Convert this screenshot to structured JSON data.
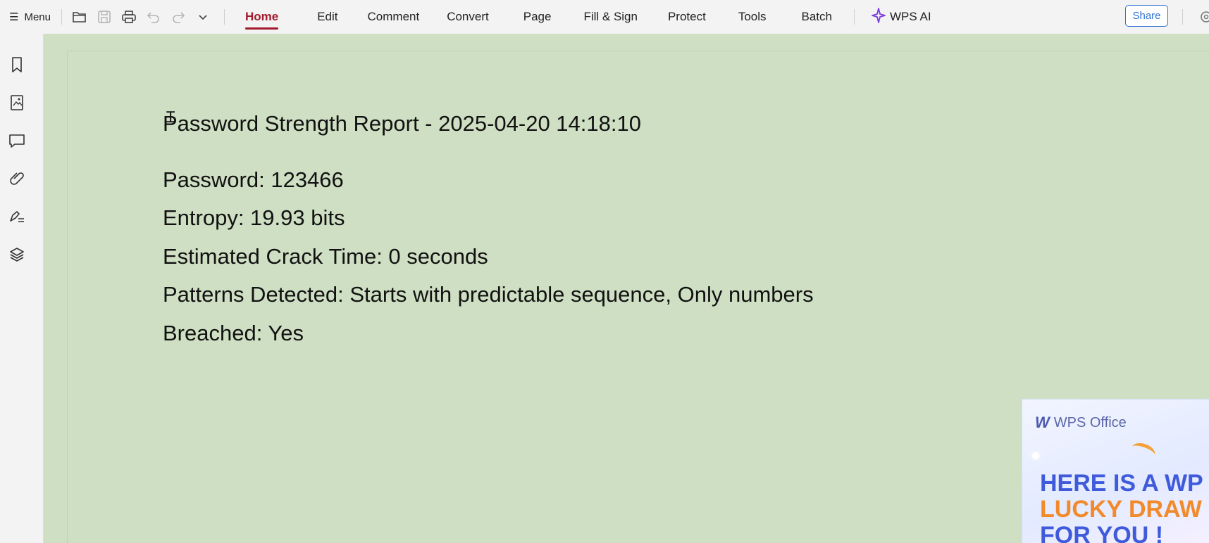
{
  "toolbar": {
    "menu_label": "Menu",
    "tabs": [
      {
        "label": "Home",
        "active": true
      },
      {
        "label": "Edit"
      },
      {
        "label": "Comment"
      },
      {
        "label": "Convert"
      },
      {
        "label": "Page"
      },
      {
        "label": "Fill & Sign"
      },
      {
        "label": "Protect"
      },
      {
        "label": "Tools"
      },
      {
        "label": "Batch"
      }
    ],
    "ai_label": "WPS AI",
    "share_label": "Share",
    "accent_color": "#a21a2c",
    "share_color": "#2e72d2",
    "quick_icons": [
      "open-folder-icon",
      "save-icon",
      "print-icon",
      "undo-icon",
      "redo-icon",
      "chevron-down-icon"
    ]
  },
  "sidebar": {
    "icons": [
      "bookmark-icon",
      "thumbnail-icon",
      "comment-icon",
      "attachment-icon",
      "signature-icon",
      "layers-icon"
    ]
  },
  "document": {
    "title": "Password Strength Report - 2025-04-20 14:18:10",
    "lines": [
      "Password: 123466",
      "Entropy: 19.93 bits",
      "Estimated Crack Time: 0 seconds",
      "Patterns Detected: Starts with predictable sequence, Only numbers",
      "Breached: Yes"
    ],
    "page_color": "#cfdfc3"
  },
  "ad": {
    "brand": "WPS Office",
    "lines": [
      "HERE IS A WP",
      "LUCKY DRAW",
      "FOR YOU !"
    ]
  }
}
